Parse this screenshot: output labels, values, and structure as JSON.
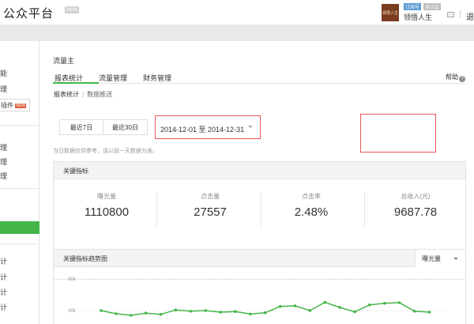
{
  "topbar": {
    "brand": "公众平台",
    "beta_label": "beta",
    "avatar_text": "领悟人生",
    "badge_subscription": "订阅号",
    "badge_unverified": "未认证",
    "account_name": "领悟人生",
    "exit_label": "退"
  },
  "sidebar": {
    "items": [
      {
        "label": "能"
      },
      {
        "label": "理"
      },
      {
        "label": "插件"
      },
      {
        "label": "理"
      },
      {
        "label": "理"
      },
      {
        "label": "理"
      },
      {
        "label": "计"
      },
      {
        "label": "计"
      },
      {
        "label": "计"
      },
      {
        "label": "计"
      }
    ],
    "new_badge": "NEW"
  },
  "main": {
    "page_title": "流量主",
    "tabs": [
      {
        "label": "报表统计"
      },
      {
        "label": "流量管理"
      },
      {
        "label": "财务管理"
      }
    ],
    "help_label": "帮助",
    "help_icon_text": "?",
    "subnav": {
      "active": "报表统计",
      "separator": "|",
      "inactive": "数据推送"
    },
    "date": {
      "last7": "最近7日",
      "last30": "最近30日",
      "range": "2014-12-01 至 2014-12-31"
    },
    "note": "当日数据仅供参考，请以前一天数据为准。",
    "key_metrics": {
      "title": "关键指标",
      "items": [
        {
          "label": "曝光量",
          "value": "1110800"
        },
        {
          "label": "点击量",
          "value": "27557"
        },
        {
          "label": "点击率",
          "value": "2.48%"
        },
        {
          "label": "总收入(元)",
          "value": "9687.78"
        }
      ]
    },
    "trend": {
      "title": "关键指标趋势图",
      "selected_metric": "曝光量"
    }
  },
  "chart_data": {
    "type": "line",
    "title": "关键指标趋势图",
    "ylabel": "",
    "ytick_labels": [
      "50k",
      "40k"
    ],
    "ylim": [
      30000,
      50000
    ],
    "x": [
      1,
      2,
      3,
      4,
      5,
      6,
      7,
      8,
      9,
      10,
      11,
      12,
      13,
      14,
      15,
      16,
      17,
      18,
      19,
      20,
      21,
      22,
      23
    ],
    "series": [
      {
        "values": [
          40000,
          39000,
          38500,
          39200,
          38800,
          40200,
          39800,
          40000,
          39500,
          39700,
          38900,
          39300,
          41300,
          41500,
          40000,
          42600,
          41000,
          39600,
          41800,
          42300,
          42500,
          39800,
          39500
        ]
      }
    ],
    "colors": {
      "line": "#44b549"
    },
    "grid": true
  }
}
